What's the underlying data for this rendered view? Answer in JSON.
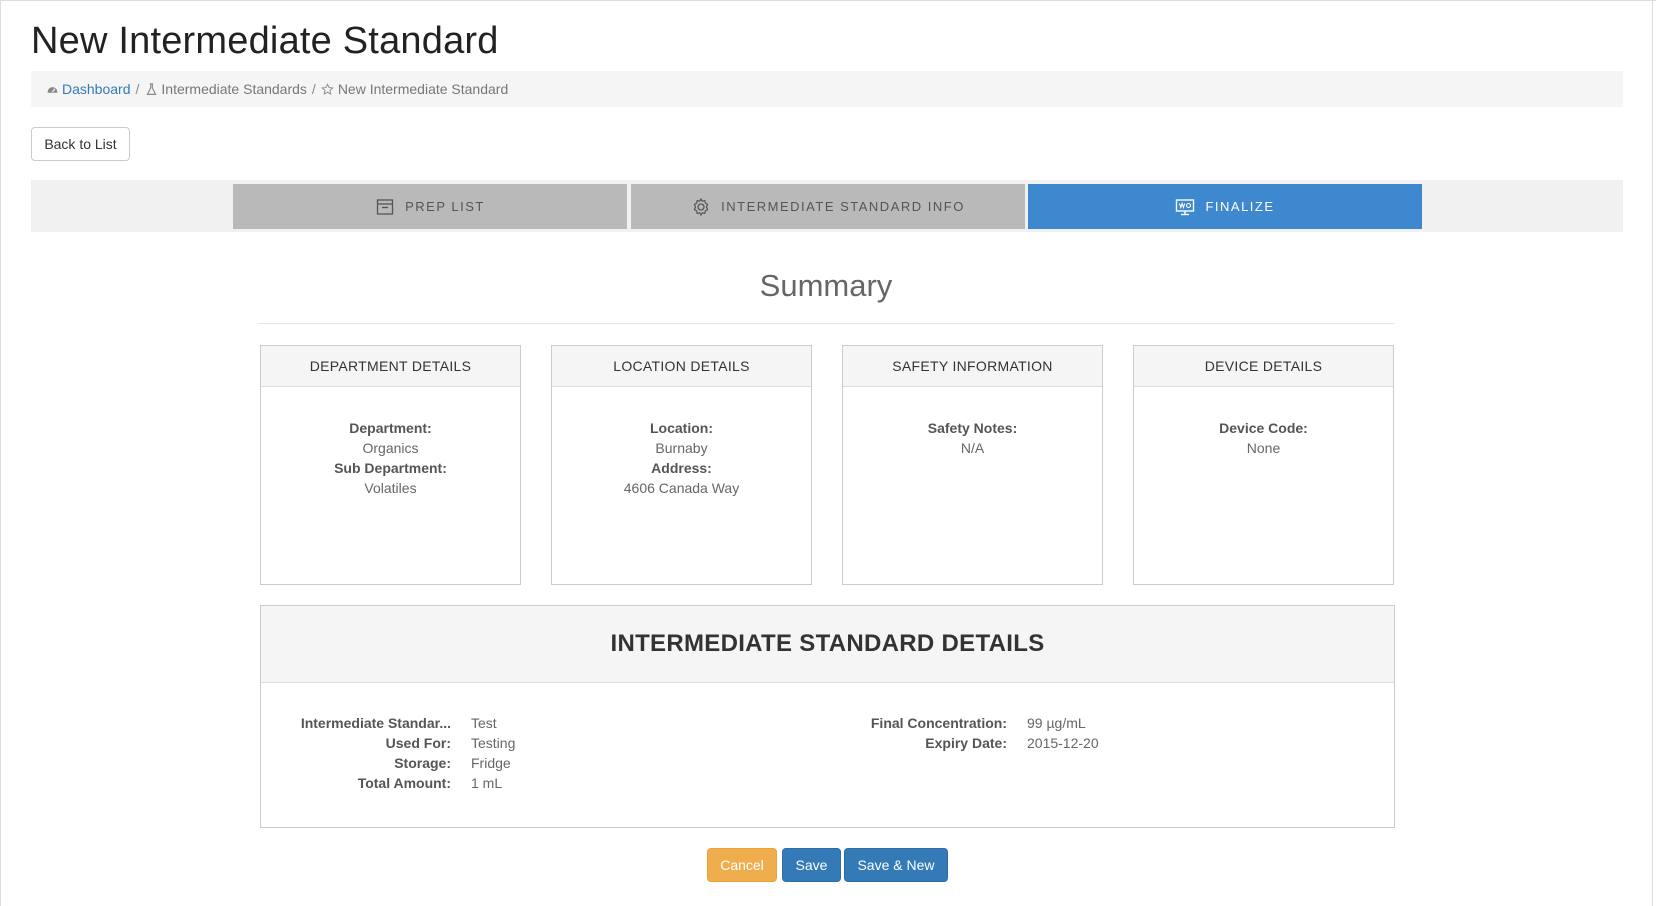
{
  "page": {
    "title": "New Intermediate Standard"
  },
  "breadcrumb": {
    "items": [
      {
        "label": "Dashboard",
        "icon": "dashboard-icon",
        "link": true
      },
      {
        "label": "Intermediate Standards",
        "icon": "flask-icon",
        "link": false
      },
      {
        "label": "New Intermediate Standard",
        "icon": "star-icon",
        "link": false
      }
    ],
    "separator": "/"
  },
  "actions": {
    "back_label": "Back to List"
  },
  "wizard": {
    "steps": [
      {
        "label": "PREP LIST",
        "icon": "list-icon",
        "active": false
      },
      {
        "label": "INTERMEDIATE STANDARD INFO",
        "icon": "gear-icon",
        "active": false
      },
      {
        "label": "FINALIZE",
        "icon": "presentation-icon",
        "active": true
      }
    ],
    "active_color": "#3d88cf",
    "inactive_color": "#b9b9b9"
  },
  "summary": {
    "title": "Summary",
    "cards": [
      {
        "header": "DEPARTMENT DETAILS",
        "fields": [
          {
            "label": "Department:",
            "value": "Organics"
          },
          {
            "label": "Sub Department:",
            "value": "Volatiles"
          }
        ]
      },
      {
        "header": "LOCATION DETAILS",
        "fields": [
          {
            "label": "Location:",
            "value": "Burnaby"
          },
          {
            "label": "Address:",
            "value": "4606 Canada Way"
          }
        ]
      },
      {
        "header": "SAFETY INFORMATION",
        "fields": [
          {
            "label": "Safety Notes:",
            "value": "N/A"
          }
        ]
      },
      {
        "header": "DEVICE DETAILS",
        "fields": [
          {
            "label": "Device Code:",
            "value": "None"
          }
        ]
      }
    ]
  },
  "details": {
    "title": "INTERMEDIATE STANDARD DETAILS",
    "left": [
      {
        "label": "Intermediate Standar...",
        "value": "Test"
      },
      {
        "label": "Used For:",
        "value": "Testing"
      },
      {
        "label": "Storage:",
        "value": "Fridge"
      },
      {
        "label": "Total Amount:",
        "value": "1 mL"
      }
    ],
    "right": [
      {
        "label": "Final Concentration:",
        "value": "99 µg/mL"
      },
      {
        "label": "Expiry Date:",
        "value": "2015-12-20"
      }
    ]
  },
  "footer_buttons": {
    "cancel": "Cancel",
    "save": "Save",
    "save_new": "Save & New",
    "cancel_color": "#f0ad4e",
    "primary_color": "#337ab7"
  }
}
